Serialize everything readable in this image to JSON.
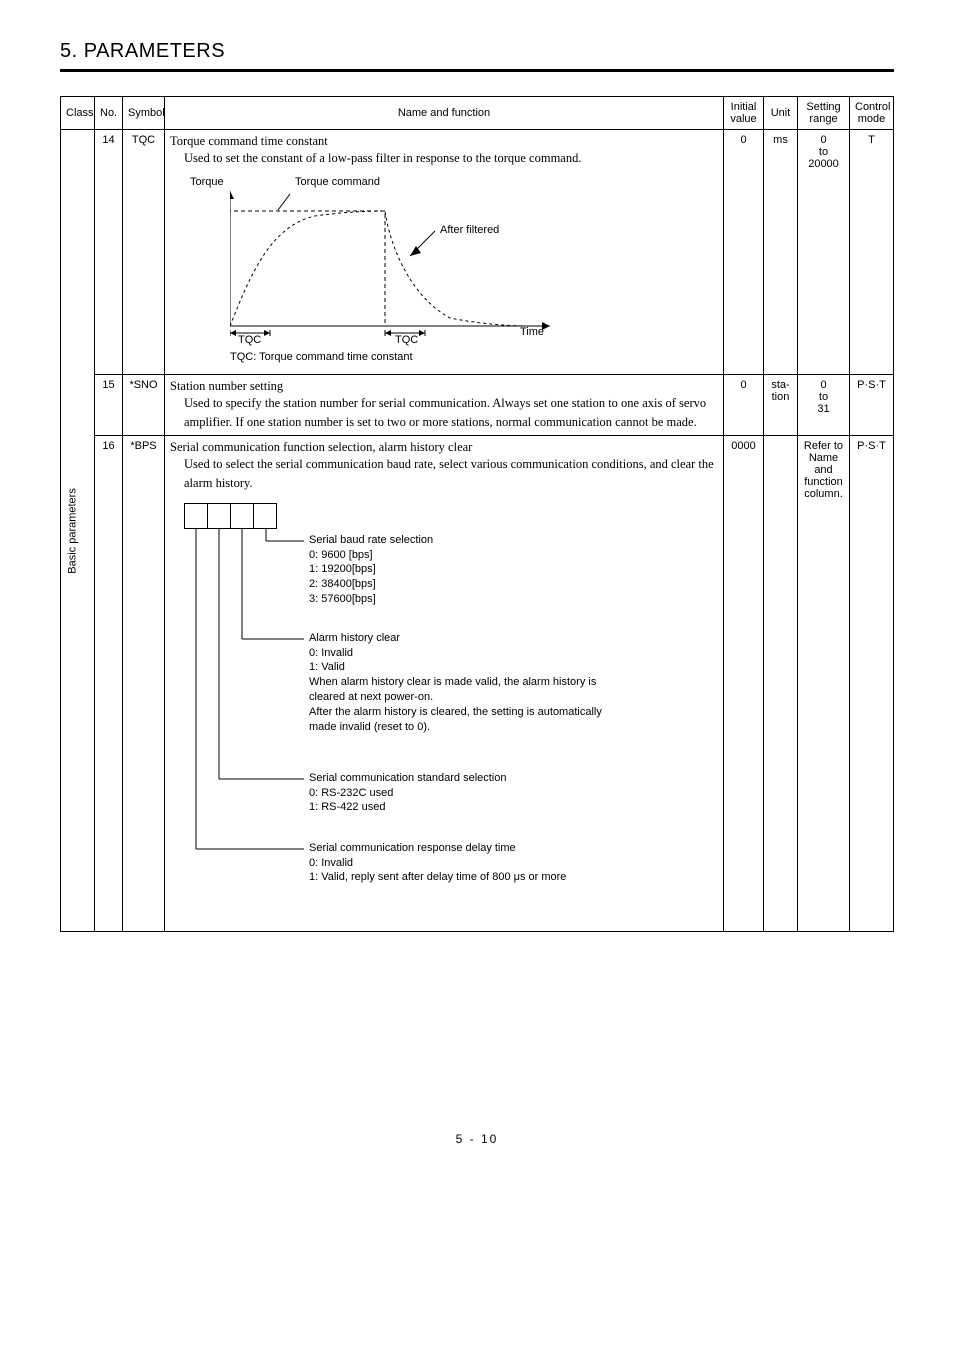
{
  "section_title": "5. PARAMETERS",
  "page_label": "5 -  10",
  "headers": {
    "class": "Class",
    "no": "No.",
    "symbol": "Symbol",
    "name": "Name and function",
    "initial": "Initial value",
    "unit": "Unit",
    "setting": "Setting range",
    "control": "Control mode"
  },
  "class_label": "Basic parameters",
  "rows": [
    {
      "no": "14",
      "symbol": "TQC",
      "title": "Torque command time constant",
      "body": "Used to set the constant of a low-pass filter in response to the torque command.",
      "initial": "0",
      "unit": "ms",
      "setting": "0\nto\n20000",
      "control": "T",
      "diagram": {
        "torque_label": "Torque",
        "torque_command": "Torque command",
        "after_filtered": "After filtered",
        "tqc": "TQC",
        "time": "Time",
        "caption": "TQC: Torque command time constant"
      }
    },
    {
      "no": "15",
      "symbol": "*SNO",
      "title": "Station number setting",
      "body": "Used to specify the station number for serial communication. Always set one station to one axis of servo amplifier. If one station number is set to two or more stations, normal communication cannot be made.",
      "initial": "0",
      "unit": "sta-\ntion",
      "setting": "0\nto\n31",
      "control": "P·S·T"
    },
    {
      "no": "16",
      "symbol": "*BPS",
      "title": "Serial communication function selection, alarm history clear",
      "body": "Used to select the serial communication baud rate, select various communication conditions, and clear the alarm history.",
      "initial": "0000",
      "unit": "",
      "setting": "Refer to Name and function column.",
      "control": "P·S·T",
      "branches": {
        "baud": "Serial baud rate selection\n0: 9600  [bps]\n1: 19200[bps]\n2: 38400[bps]\n3: 57600[bps]",
        "alarm": "Alarm history clear\n0: Invalid\n1: Valid\nWhen alarm history clear is made valid, the alarm history is cleared at next power-on.\nAfter the alarm history is cleared, the setting is automatically made invalid (reset to 0).",
        "standard": "Serial communication standard selection\n0: RS-232C used\n1: RS-422 used",
        "delay": "Serial communication response delay time\n0: Invalid\n1: Valid, reply sent after delay time of 800 μs or more"
      }
    }
  ]
}
